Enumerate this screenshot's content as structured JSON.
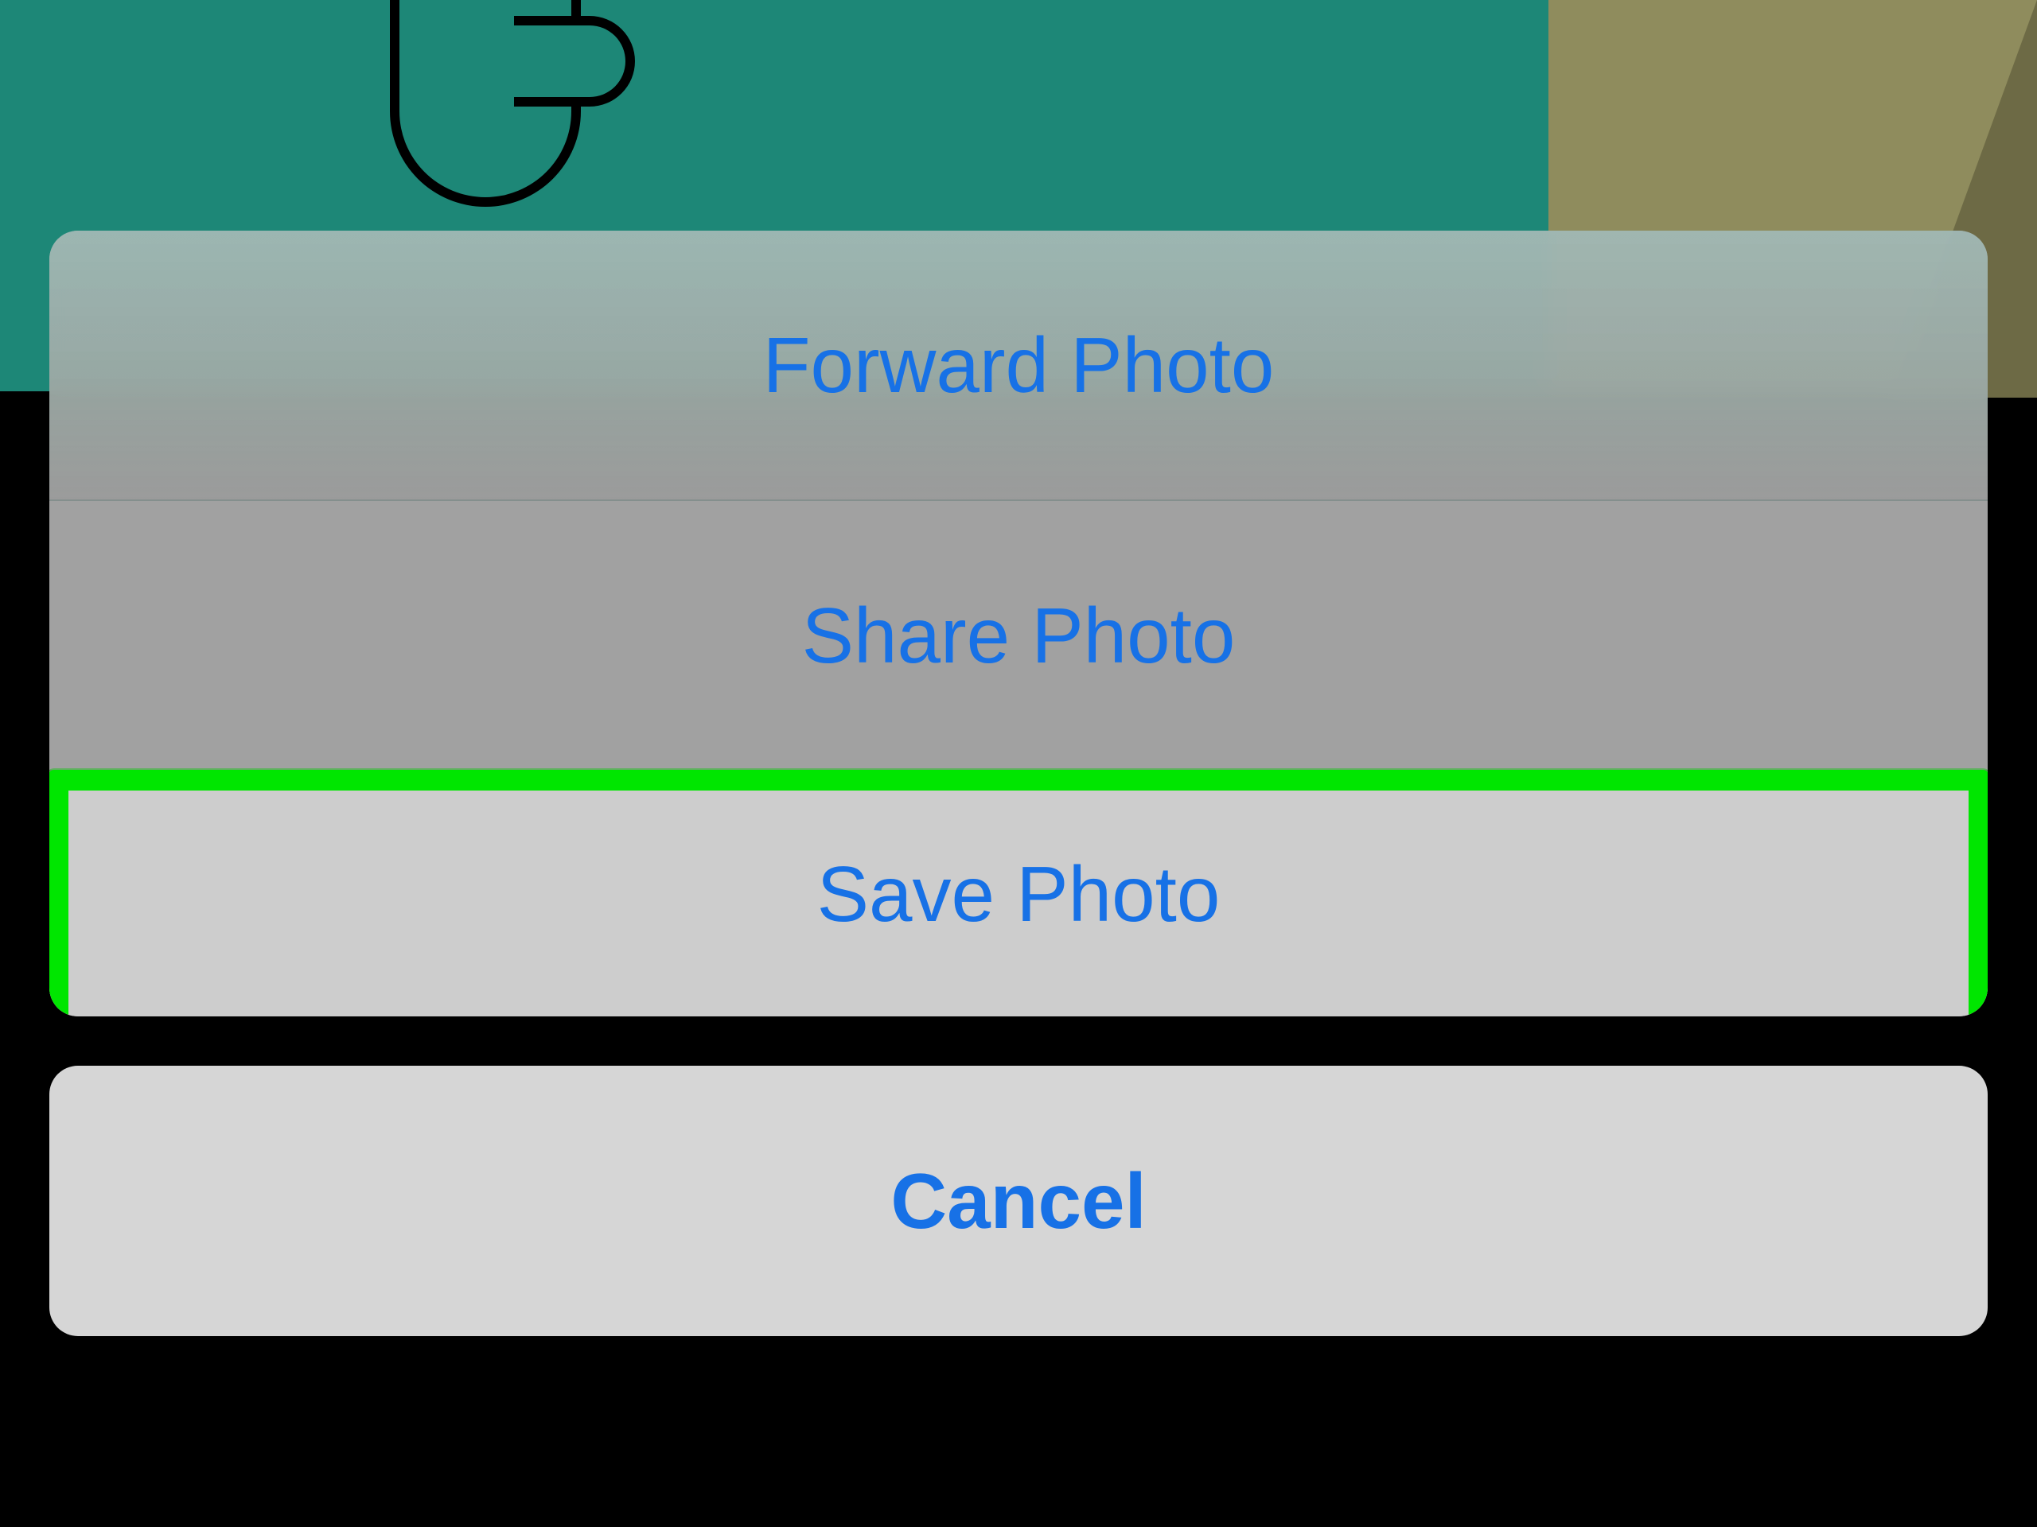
{
  "actionSheet": {
    "options": {
      "forward": "Forward Photo",
      "share": "Share Photo",
      "save": "Save Photo"
    },
    "cancel": "Cancel",
    "highlightedOption": "save"
  },
  "colors": {
    "action_text": "#1771e6",
    "highlight_border": "#00e600",
    "bg_teal": "#1d8777",
    "bg_olive": "#8f8c5d"
  }
}
